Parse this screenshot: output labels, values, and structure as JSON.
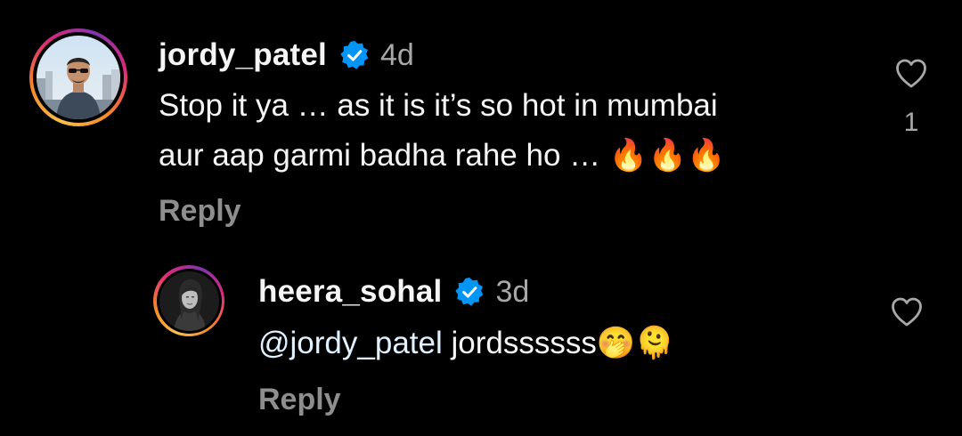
{
  "comments": [
    {
      "username": "jordy_patel",
      "verified": true,
      "timestamp": "4d",
      "text_line1": "Stop it ya … as it is it’s so hot in mumbai",
      "text_line2": "aur aap garmi badha rahe ho … 🔥🔥🔥",
      "reply_label": "Reply",
      "like_count": "1",
      "avatar_icon": "profile-photo-man-sunglasses"
    },
    {
      "username": "heera_sohal",
      "verified": true,
      "timestamp": "3d",
      "mention": "@jordy_patel",
      "text": " jordssssss🤭🫠",
      "reply_label": "Reply",
      "avatar_icon": "profile-photo-woman-bw"
    }
  ],
  "colors": {
    "background": "#000000",
    "text": "#f5f5f5",
    "secondary": "#a8a8a8",
    "reply": "#8e8e8e",
    "verified": "#0095f6",
    "mention": "#e0f1ff"
  }
}
